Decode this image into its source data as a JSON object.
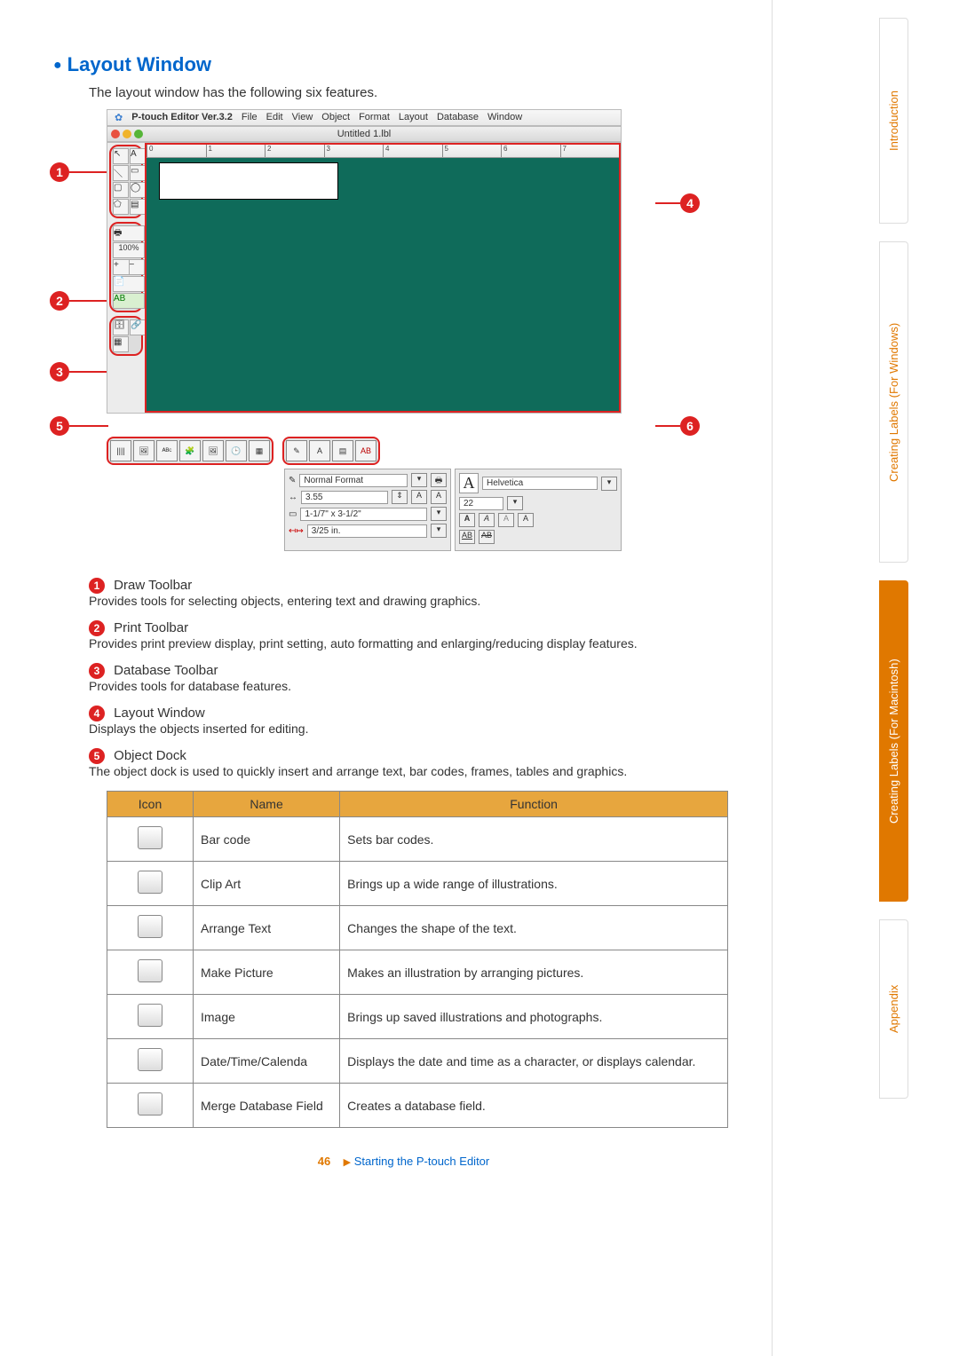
{
  "section_title": "Layout Window",
  "intro": "The layout window has the following six features.",
  "app": {
    "title": "P-touch Editor Ver.3.2",
    "menu": [
      "File",
      "Edit",
      "View",
      "Object",
      "Format",
      "Layout",
      "Database",
      "Window"
    ],
    "doc_title": "Untitled 1.lbl",
    "zoom": "100%",
    "ruler_marks": [
      "0",
      "1",
      "2",
      "3",
      "4",
      "5",
      "6",
      "7"
    ],
    "format_panel": {
      "name": "Normal Format",
      "width_value": "3.55",
      "size_label": "1-1/7\" x 3-1/2\"",
      "margin_label": "3/25 in."
    },
    "font_panel": {
      "font": "Helvetica",
      "size": "22"
    }
  },
  "features": [
    {
      "num": "1",
      "title": "Draw Toolbar",
      "desc": "Provides tools for selecting objects, entering text and drawing graphics."
    },
    {
      "num": "2",
      "title": "Print Toolbar",
      "desc": "Provides print preview display, print setting, auto formatting and enlarging/reducing display features."
    },
    {
      "num": "3",
      "title": "Database Toolbar",
      "desc": "Provides tools for database features."
    },
    {
      "num": "4",
      "title": "Layout Window",
      "desc": "Displays the objects inserted for editing."
    },
    {
      "num": "5",
      "title": "Object Dock",
      "desc": "The object dock is used to quickly insert and arrange text, bar codes, frames, tables and graphics."
    }
  ],
  "table": {
    "headers": [
      "Icon",
      "Name",
      "Function"
    ],
    "rows": [
      {
        "icon": "barcode-icon",
        "name": "Bar code",
        "func": "Sets bar codes."
      },
      {
        "icon": "clipart-icon",
        "name": "Clip Art",
        "func": "Brings up a wide range of illustrations."
      },
      {
        "icon": "arrange-text-icon",
        "name": "Arrange Text",
        "func": "Changes the shape of the text."
      },
      {
        "icon": "make-picture-icon",
        "name": "Make Picture",
        "func": "Makes an illustration by arranging pictures."
      },
      {
        "icon": "image-icon",
        "name": "Image",
        "func": "Brings up saved illustrations and photographs."
      },
      {
        "icon": "datetime-icon",
        "name": "Date/Time/Calenda",
        "func": "Displays the date and time as a character, or displays calendar."
      },
      {
        "icon": "merge-db-icon",
        "name": "Merge Database Field",
        "func": "Creates a database field."
      }
    ]
  },
  "callouts": {
    "c1": "1",
    "c2": "2",
    "c3": "3",
    "c4": "4",
    "c5": "5",
    "c6": "6"
  },
  "sidebar": {
    "intro": "Introduction",
    "win": "Creating Labels (For Windows)",
    "mac": "Creating Labels (For Macintosh)",
    "appendix": "Appendix"
  },
  "footer": {
    "page": "46",
    "breadcrumb": "Starting the P-touch Editor"
  },
  "dock_icon_names": [
    "barcode-icon",
    "clipart-icon",
    "arrange-text-icon",
    "make-picture-icon",
    "image-icon",
    "datetime-icon",
    "merge-db-icon"
  ],
  "dock_right_icon_names": [
    "style-icon",
    "text-a-icon",
    "layout-icon",
    "ab-icon"
  ]
}
